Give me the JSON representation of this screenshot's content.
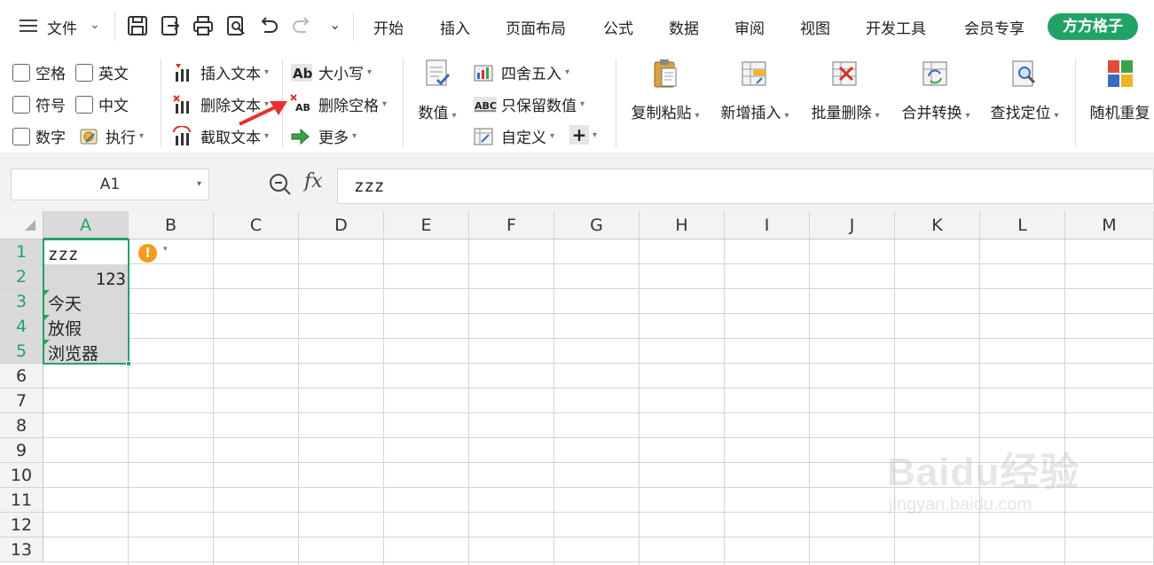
{
  "menubar": {
    "file_label": "文件",
    "tabs": [
      "开始",
      "插入",
      "页面布局",
      "公式",
      "数据",
      "审阅",
      "视图",
      "开发工具",
      "会员专享"
    ],
    "brand_button": "方方格子"
  },
  "ribbon": {
    "checkboxes": [
      "空格",
      "英文",
      "符号",
      "中文",
      "数字"
    ],
    "execute": "执行",
    "insert_text": "插入文本",
    "delete_text": "删除文本",
    "extract_text": "截取文本",
    "case": "大小写",
    "delete_space": "删除空格",
    "more": "更多",
    "value": "数值",
    "round": "四舍五入",
    "keep_value": "只保留数值",
    "custom": "自定义",
    "copy_paste": "复制粘贴",
    "add_insert": "新增插入",
    "batch_delete": "批量删除",
    "merge_convert": "合并转换",
    "find_locate": "查找定位",
    "random_repeat": "随机重复"
  },
  "formula_bar": {
    "name_box": "A1",
    "fx": "fx",
    "content": "zzz"
  },
  "sheet": {
    "columns": [
      "A",
      "B",
      "C",
      "D",
      "E",
      "F",
      "G",
      "H",
      "I",
      "J",
      "K",
      "L",
      "M"
    ],
    "rows": [
      "1",
      "2",
      "3",
      "4",
      "5",
      "6",
      "7",
      "8",
      "9",
      "10",
      "11",
      "12",
      "13"
    ],
    "cells": {
      "A1": "zzz",
      "A2": "123",
      "A3": "今天",
      "A4": "放假",
      "A5": "浏览器"
    }
  },
  "watermark": {
    "brand": "Baidu经验",
    "url": "jingyan.baidu.com"
  },
  "colors": {
    "accent": "#21a366",
    "selection": "#d9d9d9",
    "arrow": "#e8302a"
  }
}
